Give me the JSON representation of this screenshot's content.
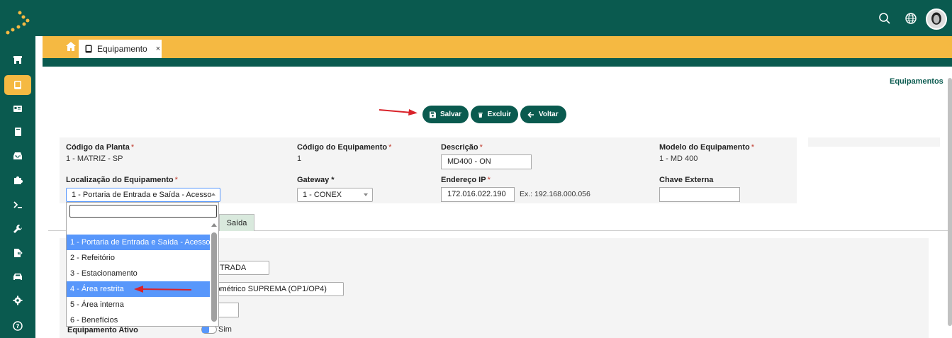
{
  "header": {
    "tab_label": "Equipamento",
    "tab_close": "×",
    "page_title": "Equipamentos"
  },
  "sidebar": {
    "items": [
      {
        "icon": "store-icon"
      },
      {
        "icon": "tablet-icon",
        "active": true
      },
      {
        "icon": "id-card-icon"
      },
      {
        "icon": "book-icon"
      },
      {
        "icon": "inbox-icon"
      },
      {
        "icon": "puzzle-icon"
      },
      {
        "icon": "terminal-icon"
      },
      {
        "icon": "wrench-icon"
      },
      {
        "icon": "file-export-icon"
      },
      {
        "icon": "car-icon"
      },
      {
        "icon": "gear-icon"
      },
      {
        "icon": "help-icon"
      }
    ]
  },
  "toolbar": {
    "save_label": "Salvar",
    "delete_label": "Excluir",
    "back_label": "Voltar"
  },
  "form": {
    "plant_code": {
      "label": "Código da Planta",
      "value": "1 - MATRIZ - SP"
    },
    "equipment_code": {
      "label": "Código do Equipamento",
      "value": "1"
    },
    "description": {
      "label": "Descrição",
      "value": "MD400 - ON"
    },
    "model": {
      "label": "Modelo do Equipamento",
      "value": "1 - MD 400"
    },
    "location": {
      "label": "Localização do Equipamento",
      "value": "1 - Portaria de Entrada e Saída - Acesso"
    },
    "gateway": {
      "label": "Gateway *",
      "value": "1 - CONEX"
    },
    "ip": {
      "label": "Endereço IP",
      "value": "172.016.022.190",
      "hint": "Ex.: 192.168.000.056"
    },
    "external_key": {
      "label": "Chave Externa",
      "value": ""
    },
    "required_mark": "*"
  },
  "tabs": {
    "exit_label": "Saída"
  },
  "lower_form": {
    "direction_value": "NTRADA",
    "reader_value": "iométrico SUPREMA (OP1/OP4)",
    "active_label": "Equipamento Ativo",
    "active_option": "Sim"
  },
  "dropdown": {
    "search_value": "",
    "options": [
      "1 - Portaria de Entrada e Saída - Acesso",
      "2 - Refeitório",
      "3 - Estacionamento",
      "4 - Área restrita",
      "5 - Área interna",
      "6 - Benefícios"
    ]
  },
  "colors": {
    "brand": "#0a5a4f",
    "accent": "#f5b942",
    "highlight": "#5897fb",
    "annotation_arrow": "#d9232a"
  }
}
